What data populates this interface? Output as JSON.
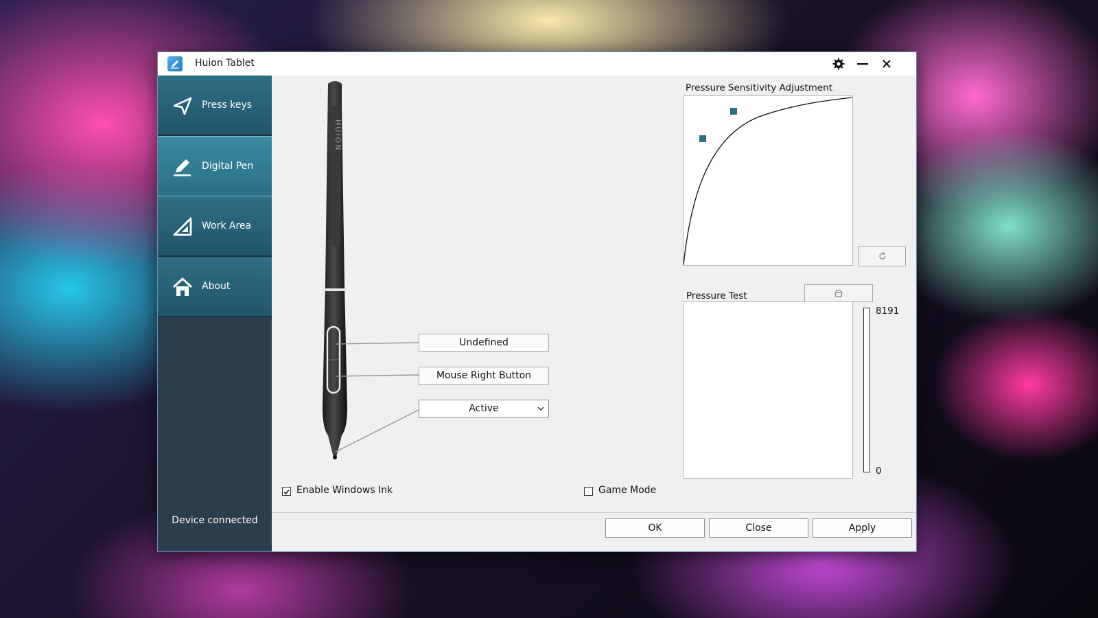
{
  "window": {
    "title": "Huion Tablet"
  },
  "sidebar": {
    "items": [
      {
        "label": "Press keys",
        "icon": "send-arrow-icon"
      },
      {
        "label": "Digital Pen",
        "icon": "pen-icon"
      },
      {
        "label": "Work Area",
        "icon": "triangle-ruler-icon"
      },
      {
        "label": "About",
        "icon": "home-icon"
      }
    ],
    "active_index": 1,
    "status": "Device connected"
  },
  "pen": {
    "brand": "HUION",
    "upper_button": "Undefined",
    "lower_button": "Mouse Right Button",
    "tip_mode": "Active"
  },
  "pressure_curve": {
    "title": "Pressure Sensitivity Adjustment",
    "reset_icon": "reset-icon"
  },
  "pressure_test": {
    "title": "Pressure Test",
    "clear_icon": "eraser-icon",
    "max_label": "8191",
    "min_label": "0",
    "level": 0
  },
  "options": {
    "windows_ink_label": "Enable Windows Ink",
    "windows_ink_checked": true,
    "game_mode_label": "Game Mode",
    "game_mode_checked": false
  },
  "footer": {
    "ok": "OK",
    "close": "Close",
    "apply": "Apply"
  },
  "colors": {
    "accent": "#2e6f84",
    "sidebar_bg": "#2b3e4e",
    "curve_point": "#2d6e85"
  }
}
